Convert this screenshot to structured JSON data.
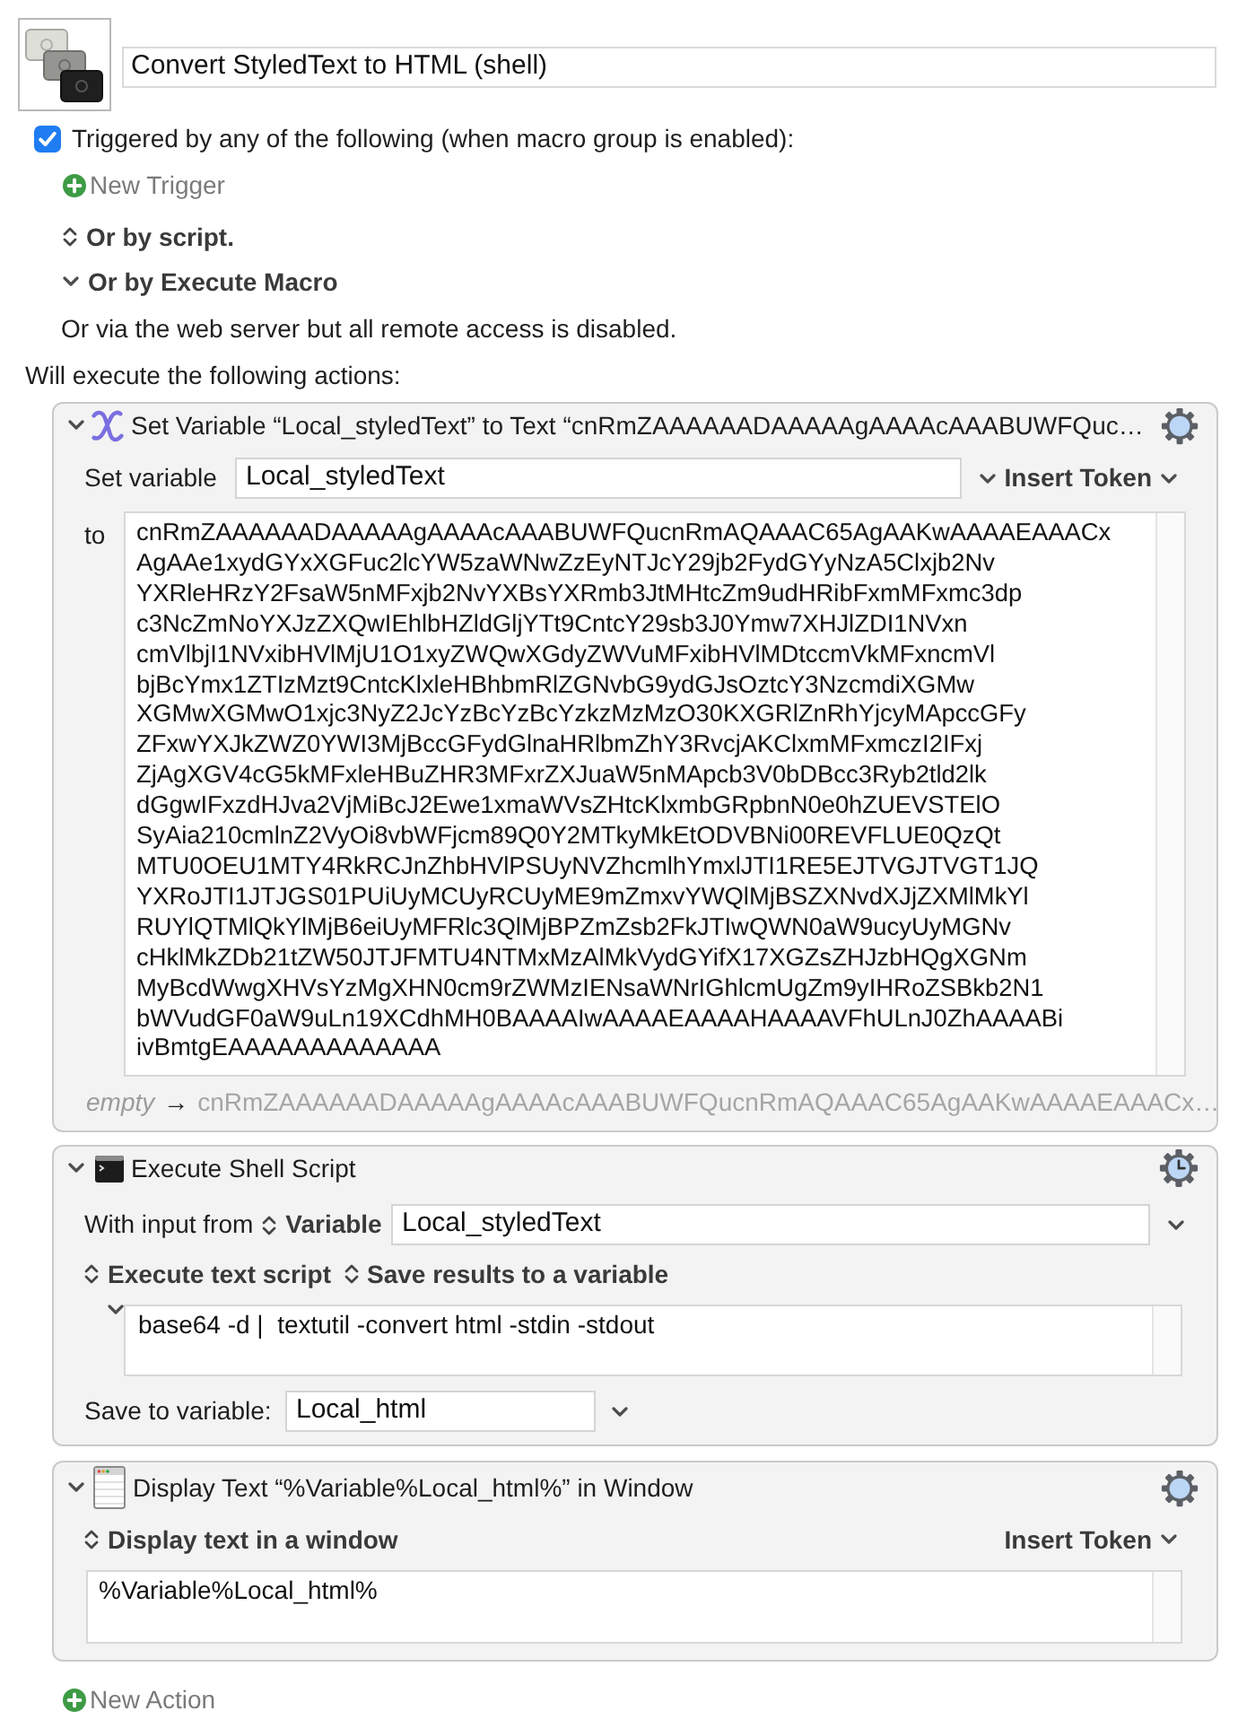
{
  "macro": {
    "name": "Convert StyledText to HTML (shell)"
  },
  "trigger_section": {
    "label": "Triggered by any of the following (when macro group is enabled):",
    "checked": true,
    "new_trigger": "New Trigger",
    "options": [
      {
        "kind": "popup",
        "label": "Or by script."
      },
      {
        "kind": "disclosure",
        "label": "Or by Execute Macro",
        "expanded": true
      }
    ],
    "note": "Or via the web server but all remote access is disabled."
  },
  "actions_heading": "Will execute the following actions:",
  "actions": [
    {
      "kind": "set_variable",
      "expanded": true,
      "title": "Set Variable “Local_styledText” to Text “cnRmZAAAAAADAAAAAgAAAAcAAABUWFQuc…",
      "variable_label": "Set variable",
      "variable": "Local_styledText",
      "insert_token": "Insert Token",
      "text_label": "to",
      "text": "cnRmZAAAAAADAAAAAgAAAAcAAABUWFQucnRmAQAAAC65AgAAKwAAAAEAAACx\nAgAAe1xydGYxXGFuc2lcYW5zaWNwZzEyNTJcY29jb2FydGYyNzA5Clxjb2Nv\nYXRleHRzY2FsaW5nMFxjb2NvYXBsYXRmb3JtMHtcZm9udHRibFxmMFxmc3dp\nc3NcZmNoYXJzZXQwIEhlbHZldGljYTt9CntcY29sb3J0Ymw7XHJlZDI1NVxn\ncmVlbjI1NVxibHVlMjU1O1xyZWQwXGdyZWVuMFxibHVlMDtccmVkMFxncmVl\nbjBcYmx1ZTIzMzt9CntcKlxleHBhbmRlZGNvbG9ydGJsOztcY3NzcmdiXGMw\nXGMwXGMwO1xjc3NyZ2JcYzBcYzBcYzkzMzMzO30KXGRlZnRhYjcyMApccGFy\nZFxwYXJkZWZ0YWI3MjBccGFydGlnaHRlbmZhY3RvcjAKClxmMFxmczI2IFxj\nZjAgXGV4cG5kMFxleHBuZHR3MFxrZXJuaW5nMApcb3V0bDBcc3Ryb2tld2lk\ndGgwIFxzdHJva2VjMiBcJ2Ewe1xmaWVsZHtcKlxmbGRpbnN0e0hZUEVSTElO\nSyAia210cmlnZ2VyOi8vbWFjcm89Q0Y2MTkyMkEtODVBNi00REVFLUE0QzQt\nMTU0OEU1MTY4RkRCJnZhbHVlPSUyNVZhcmlhYmxlJTI1RE5EJTVGJTVGT1JQ\nYXRoJTI1JTJGS01PUiUyMCUyRCUyME9mZmxvYWQlMjBSZXNvdXJjZXMlMkYl\nRUYlQTMlQkYlMjB6eiUyMFRlc3QlMjBPZmZsb2FkJTIwQWN0aW9ucyUyMGNv\ncHklMkZDb21tZW50JTJFMTU4NTMxMzAlMkVydGYifX17XGZsZHJzbHQgXGNm\nMyBcdWwgXHVsYzMgXHN0cm9rZWMzIENsaWNrIGhlcmUgZm9yIHRoZSBkb2N1\nbWVudGF0aW9uLn19XCdhMH0BAAAAIwAAAAEAAAAHAAAAVFhULnJ0ZhAAAABi\nivBmtgEAAAAAAAAAAAAA",
      "preview": {
        "empty": "empty",
        "arrow": "→",
        "result": "cnRmZAAAAAADAAAAAgAAAAcAAABUWFQucnRmAQAAAC65AgAAKwAAAAEAAACx…"
      }
    },
    {
      "kind": "shell_script",
      "expanded": true,
      "title": "Execute Shell Script",
      "input_label": "With input from",
      "input_source": "Variable",
      "input_variable": "Local_styledText",
      "execute_mode": "Execute text script",
      "output_mode": "Save results to a variable",
      "script_expanded": true,
      "script": "base64 -d |  textutil -convert html -stdin -stdout",
      "save_label": "Save to variable:",
      "save_variable": "Local_html"
    },
    {
      "kind": "display_text",
      "expanded": true,
      "title": "Display Text “%Variable%Local_html%” in Window",
      "mode": "Display text in a window",
      "insert_token": "Insert Token",
      "text": "%Variable%Local_html%"
    }
  ],
  "new_action": "New Action"
}
